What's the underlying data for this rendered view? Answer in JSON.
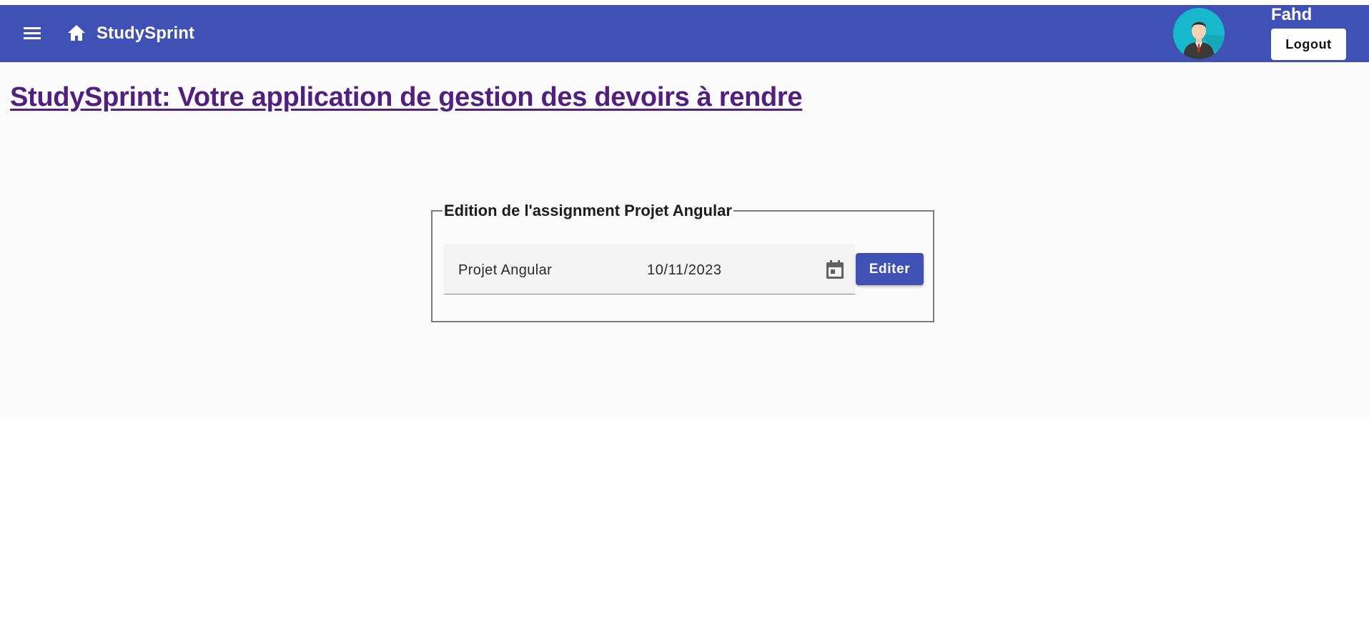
{
  "toolbar": {
    "menu_icon": "menu-icon",
    "home_icon": "home-icon",
    "app_name": "StudySprint",
    "user_name": "Fahd",
    "logout_label": "Logout",
    "background_color": "#3f51b5"
  },
  "main": {
    "heading": "StudySprint: Votre application de gestion des devoirs à rendre",
    "heading_color": "#51207e"
  },
  "edit_form": {
    "legend": "Edition de l'assignment Projet Angular",
    "name_value": "Projet Angular",
    "date_value": "10/11/2023",
    "calendar_icon": "calendar-icon",
    "submit_label": "Editer"
  }
}
